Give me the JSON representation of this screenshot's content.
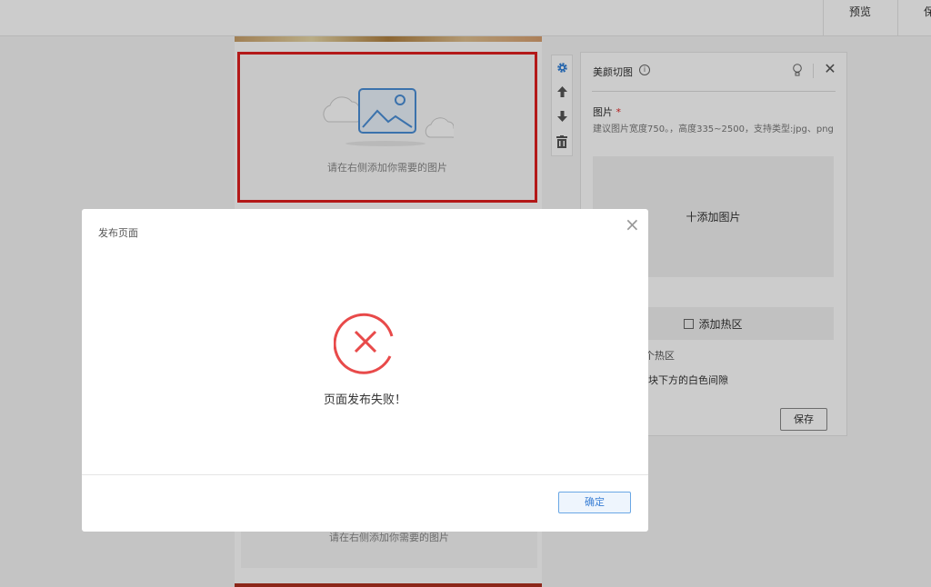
{
  "topbar": {
    "preview_label": "预览",
    "partial_label": "保"
  },
  "canvas": {
    "placeholder_text": "请在右侧添加你需要的图片",
    "placeholder_text_2": "请在右侧添加你需要的图片"
  },
  "tools": {
    "icons": [
      "gear-icon",
      "arrow-up-icon",
      "arrow-down-icon",
      "trash-icon"
    ]
  },
  "panel": {
    "title": "美颜切图",
    "image_label": "图片",
    "required_mark": "*",
    "hint": "建议图片宽度750。，高度335~2500，支持类型:jpg、png",
    "add_image_label": "十添加图片",
    "add_hotspot_label": "添加热区",
    "hotspot_count_text": "个热区",
    "gap_option_text": "块下方的白色间隙",
    "save_label": "保存"
  },
  "modal": {
    "title": "发布页面",
    "message": "页面发布失败！",
    "ok_label": "确定",
    "error_color": "#e84a4a"
  }
}
